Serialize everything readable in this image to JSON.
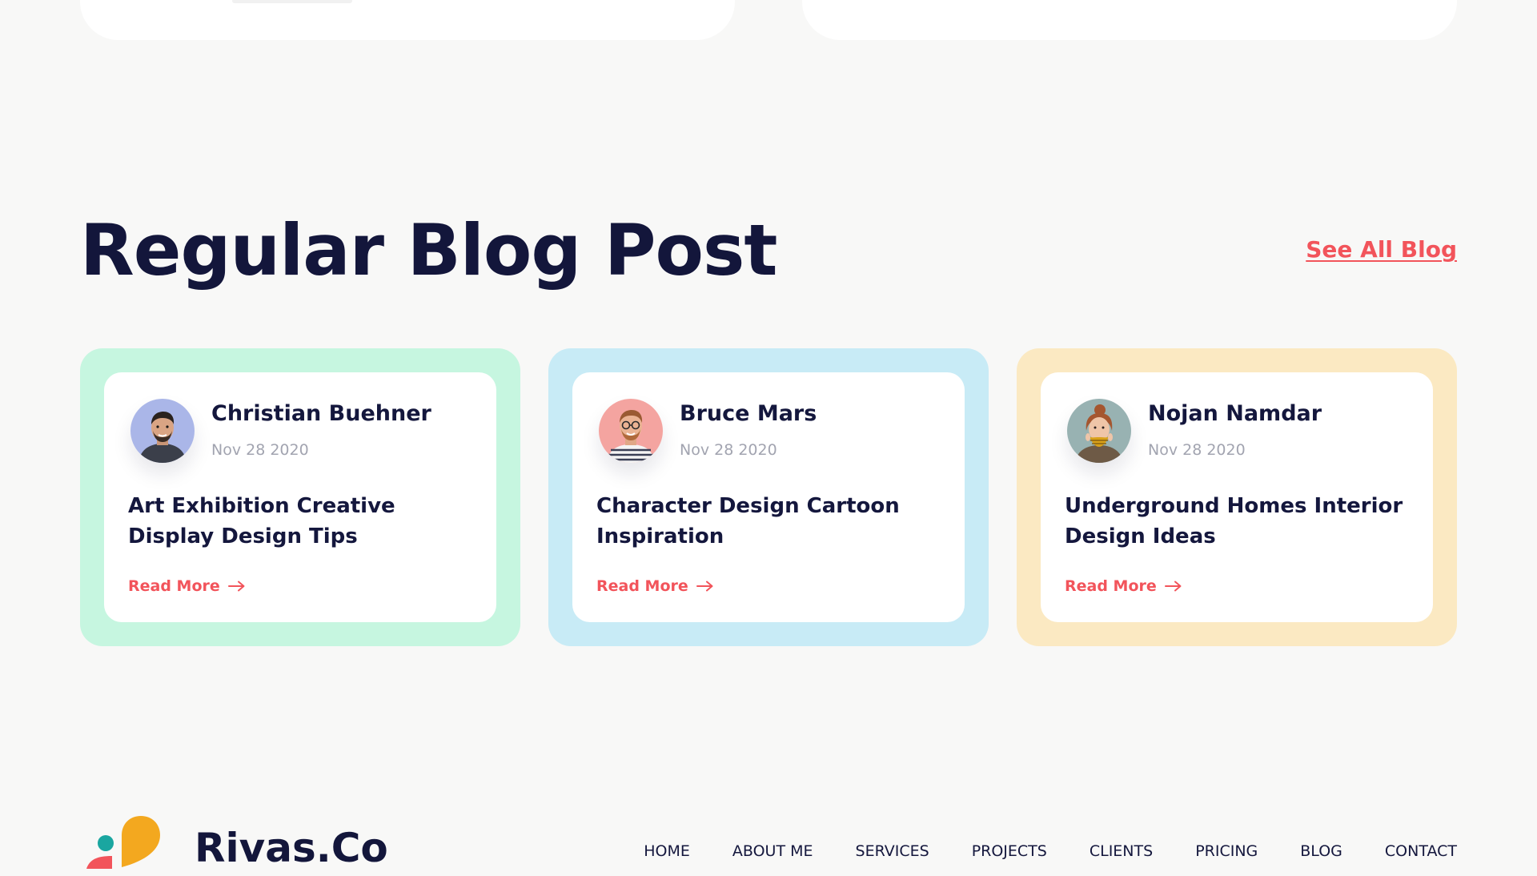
{
  "section": {
    "title": "Regular Blog Post",
    "see_all_label": "See All Blog"
  },
  "posts": [
    {
      "author": "Christian Buehner",
      "date": "Nov 28 2020",
      "title": "Art Exhibition Creative Display Design Tips",
      "read_more": "Read More",
      "frame_color": "#c6f6e0",
      "avatar_bg": "#aab6e8"
    },
    {
      "author": "Bruce Mars",
      "date": "Nov 28 2020",
      "title": "Character Design Cartoon Inspiration",
      "read_more": "Read More",
      "frame_color": "#c8ebf6",
      "avatar_bg": "#f4a4a0"
    },
    {
      "author": "Nojan Namdar",
      "date": "Nov 28 2020",
      "title": "Underground Homes Interior Design Ideas",
      "read_more": "Read More",
      "frame_color": "#fbe9c2",
      "avatar_bg": "#98b2b2"
    }
  ],
  "footer": {
    "brand": "Rivas.Co",
    "nav": [
      "HOME",
      "ABOUT ME",
      "SERVICES",
      "PROJECTS",
      "CLIENTS",
      "PRICING",
      "BLOG",
      "CONTACT"
    ]
  },
  "colors": {
    "accent": "#f2545b",
    "heading": "#13163b",
    "muted": "#a2a4b0",
    "background": "#f8f8f7",
    "logo_orange": "#f3a81f",
    "logo_teal": "#1aa6a0",
    "logo_red": "#f2545b"
  },
  "icons": {
    "read_more_arrow": "arrow-right-icon"
  }
}
